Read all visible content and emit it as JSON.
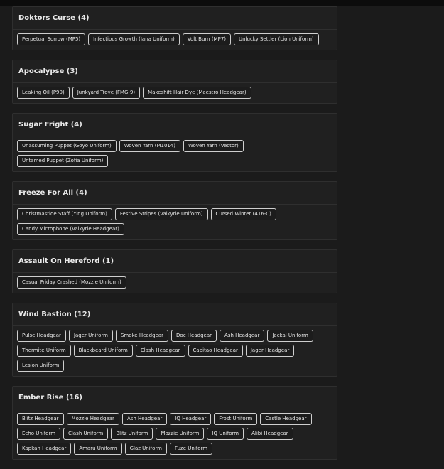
{
  "sections": [
    {
      "title": "Doktors Curse (4)",
      "items": [
        "Perpetual Sorrow (MP5)",
        "Infectious Growth (Iana Uniform)",
        "Volt Burn (MP7)",
        "Unlucky Settler (Lion Uniform)"
      ]
    },
    {
      "title": "Apocalypse (3)",
      "items": [
        "Leaking Oil (P90)",
        "Junkyard Trove (FMG-9)",
        "Makeshift Hair Dye (Maestro Headgear)"
      ]
    },
    {
      "title": "Sugar Fright (4)",
      "items": [
        "Unassuming Puppet (Goyo Uniform)",
        "Woven Yarn (M1014)",
        "Woven Yarn (Vector)",
        "Untamed Puppet (Zofia Uniform)"
      ]
    },
    {
      "title": "Freeze For All (4)",
      "items": [
        "Christmastide Staff (Ying Uniform)",
        "Festive Stripes (Valkyrie Uniform)",
        "Cursed Winter (416-C)",
        "Candy Microphone (Valkyrie Headgear)"
      ]
    },
    {
      "title": "Assault On Hereford (1)",
      "items": [
        "Casual Friday Crashed (Mozzie Uniform)"
      ]
    },
    {
      "title": "Wind Bastion (12)",
      "items": [
        "Pulse Headgear",
        "Jager Uniform",
        "Smoke Headgear",
        "Doc Headgear",
        "Ash Headgear",
        "Jackal Uniform",
        "Thermite Uniform",
        "Blackbeard Uniform",
        "Clash Headgear",
        "Capitao Headgear",
        "Jager Headgear",
        "Lesion Uniform"
      ]
    },
    {
      "title": "Ember Rise (16)",
      "items": [
        "Blitz Headgear",
        "Mozzie Headgear",
        "Ash Headgear",
        "IQ Headgear",
        "Frost Uniform",
        "Castle Headgear",
        "Echo Uniform",
        "Clash Uniform",
        "Blitz Uniform",
        "Mozzie Uniform",
        "IQ Uniform",
        "Alibi Headgear",
        "Kapkan Headgear",
        "Amaru Uniform",
        "Glaz Uniform",
        "Fuze Uniform"
      ]
    }
  ]
}
